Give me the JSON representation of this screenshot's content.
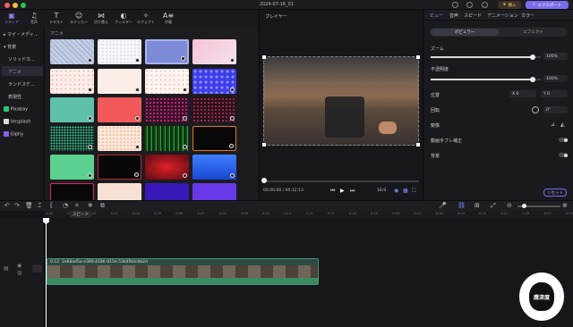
{
  "window": {
    "title": "2024-07-16_01"
  },
  "header": {
    "export_label": "エクスポート",
    "buy_label": "購入"
  },
  "toolbar": {
    "tools": [
      "メディア",
      "音声",
      "テキスト",
      "ステッカー",
      "切り替え",
      "フィルター",
      "エフェクト",
      "字幕"
    ]
  },
  "sidebar": {
    "items": [
      "マイ・メディ…",
      "背景",
      "ソリッドカ…",
      "アニメ",
      "ランドスケ…",
      "表現性",
      "Pixabay",
      "Unsplash",
      "Giphy"
    ]
  },
  "content": {
    "category_label": "アニメ"
  },
  "player": {
    "title": "プレイヤー",
    "time_current": "00:00:00",
    "time_total": "00:12:13",
    "aspect": "16:9"
  },
  "props": {
    "tabs": [
      "ビュー",
      "音声",
      "スピード",
      "アニメーション",
      "カラー"
    ],
    "subtabs": [
      "ポピュラー",
      "エフェクト"
    ],
    "zoom_label": "ズーム",
    "zoom_value": "100%",
    "zoom_level": 0.93,
    "opacity_label": "不透明度",
    "opacity_value": "100%",
    "opacity_level": 0.93,
    "position_label": "位置",
    "pos_x": "X 0",
    "pos_y": "Y 0",
    "rotation_label": "回転",
    "rotation_value": "0°",
    "mirror_label": "鏡像",
    "stabilize_label": "動画手ブレ補正",
    "background_label": "背景",
    "reset_label": "リセット"
  },
  "timeline": {
    "speed_tooltip": "スピード",
    "ticks": [
      "0:00",
      "0:01",
      "0:02",
      "0:03",
      "0:04",
      "0:05",
      "0:06",
      "0:07",
      "0:08",
      "0:09",
      "0:10",
      "0:11",
      "0:12",
      "0:13",
      "0:14",
      "0:15",
      "0:16",
      "0:17",
      "0:18",
      "0:19",
      "0:20",
      "0:21",
      "0:22",
      "0:23",
      "0:24"
    ],
    "clip": {
      "duration": "0:12",
      "name": "2e68ad5a-e380-4186-815e-53b4fb0cbb2d"
    }
  },
  "watermark": {
    "text": "應済度"
  }
}
